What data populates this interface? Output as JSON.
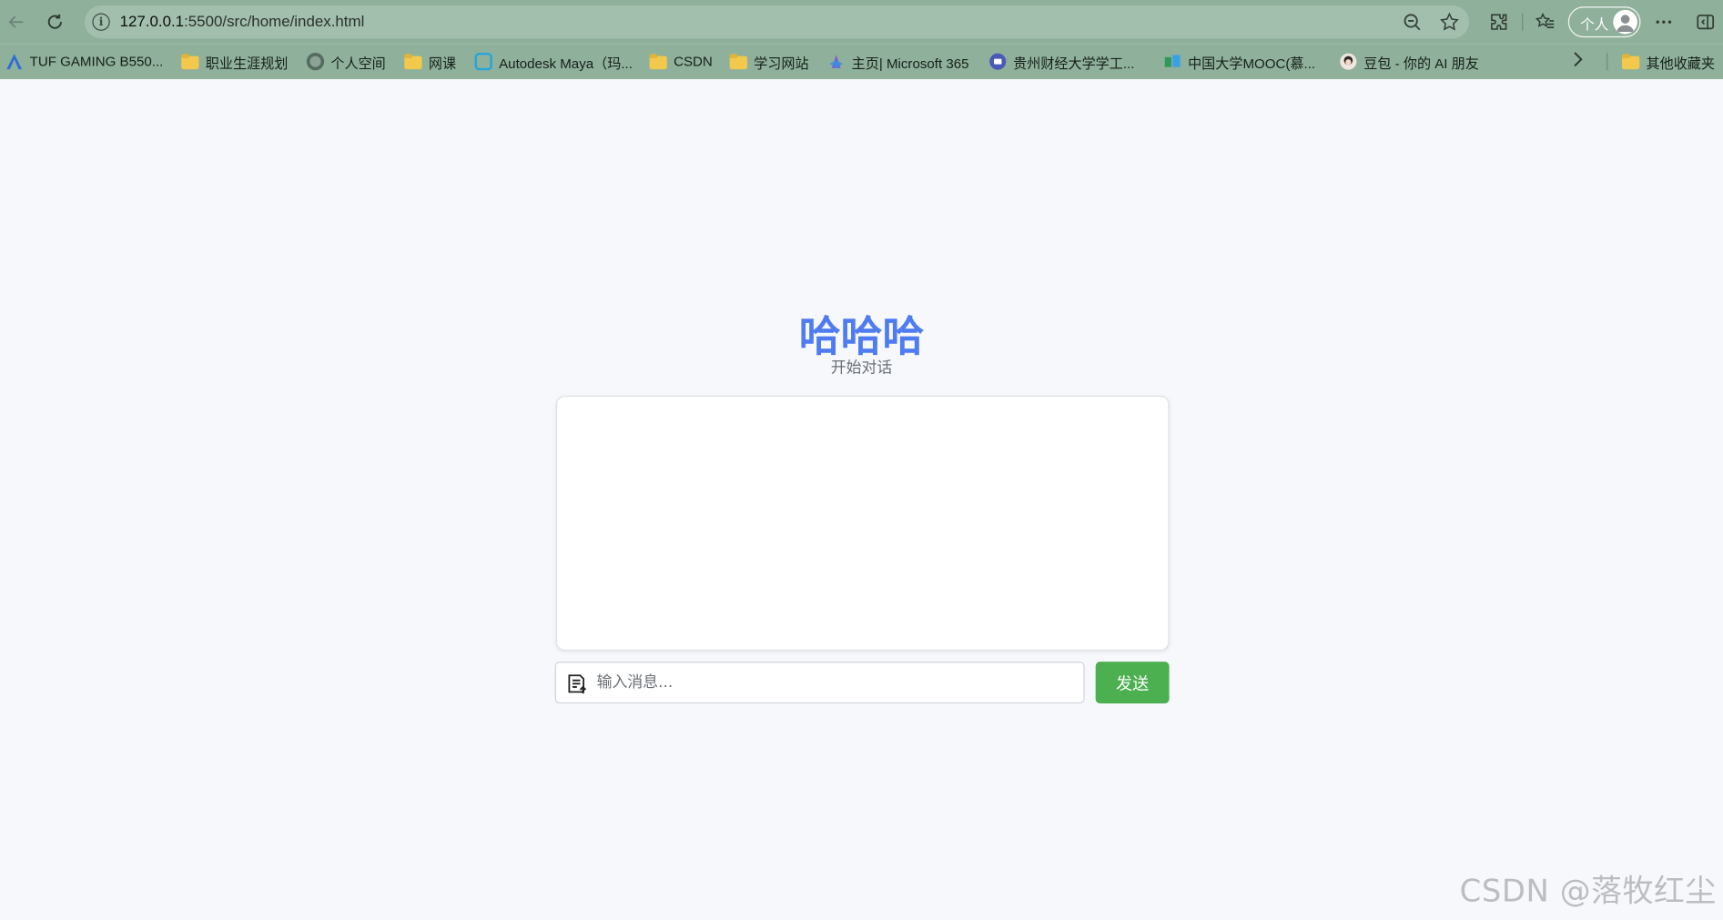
{
  "browser": {
    "url_host": "127.0.0.1",
    "url_path": ":5500/src/home/index.html",
    "profile_label": "个人"
  },
  "bookmarks": [
    {
      "label": "TUF GAMING B550...",
      "icon": "asus-icon"
    },
    {
      "label": "职业生涯规划",
      "icon": "folder-icon"
    },
    {
      "label": "个人空间",
      "icon": "globe-icon"
    },
    {
      "label": "网课",
      "icon": "folder-icon"
    },
    {
      "label": "Autodesk Maya（玛...",
      "icon": "bilibili-icon"
    },
    {
      "label": "CSDN",
      "icon": "folder-icon"
    },
    {
      "label": "学习网站",
      "icon": "folder-icon"
    },
    {
      "label": "主页| Microsoft 365",
      "icon": "microsoft365-icon"
    },
    {
      "label": "贵州财经大学学工...",
      "icon": "university-icon"
    },
    {
      "label": "中国大学MOOC(慕...",
      "icon": "mooc-icon"
    },
    {
      "label": "豆包 - 你的 AI 朋友",
      "icon": "doubao-icon"
    }
  ],
  "other_bookmarks": "其他收藏夹",
  "page": {
    "title": "哈哈哈",
    "subtitle": "开始对话",
    "input_placeholder": "输入消息...",
    "send_label": "发送"
  },
  "watermark": "CSDN @落牧红尘",
  "colors": {
    "title": "#4f7cf2",
    "send_button": "#4caf50",
    "chrome": "#8fb09a"
  }
}
